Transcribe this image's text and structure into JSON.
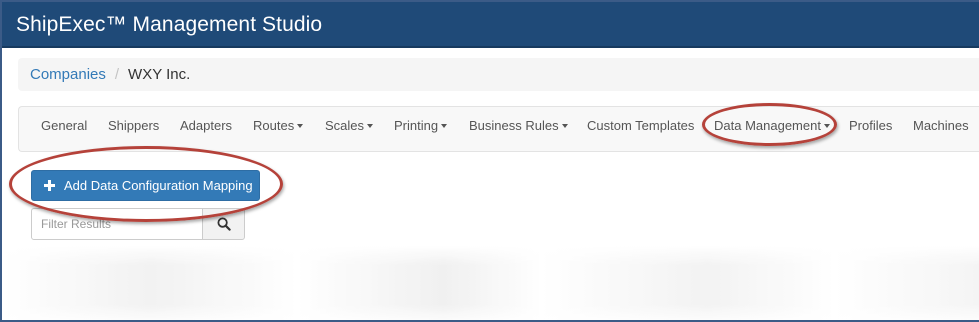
{
  "app": {
    "title": "ShipExec™ Management Studio"
  },
  "breadcrumb": {
    "parent": "Companies",
    "separator": "/",
    "current": "WXY Inc."
  },
  "tabs": [
    {
      "label": "General",
      "dropdown": false
    },
    {
      "label": "Shippers",
      "dropdown": false
    },
    {
      "label": "Adapters",
      "dropdown": false
    },
    {
      "label": "Routes",
      "dropdown": true
    },
    {
      "label": "Scales",
      "dropdown": true
    },
    {
      "label": "Printing",
      "dropdown": true
    },
    {
      "label": "Business Rules",
      "dropdown": true
    },
    {
      "label": "Custom Templates",
      "dropdown": false
    },
    {
      "label": "Data Management",
      "dropdown": true,
      "highlighted": true
    },
    {
      "label": "Profiles",
      "dropdown": false
    },
    {
      "label": "Machines",
      "dropdown": false
    }
  ],
  "actions": {
    "add_label": "Add Data Configuration Mapping"
  },
  "filter": {
    "placeholder": "Filter Results",
    "value": ""
  },
  "colors": {
    "titlebar": "#1f4a78",
    "primary_button": "#337ab7",
    "link": "#337ab7",
    "annotation_ellipse": "#b5423a"
  },
  "icons": {
    "add": "plus-icon",
    "search": "search-icon"
  }
}
